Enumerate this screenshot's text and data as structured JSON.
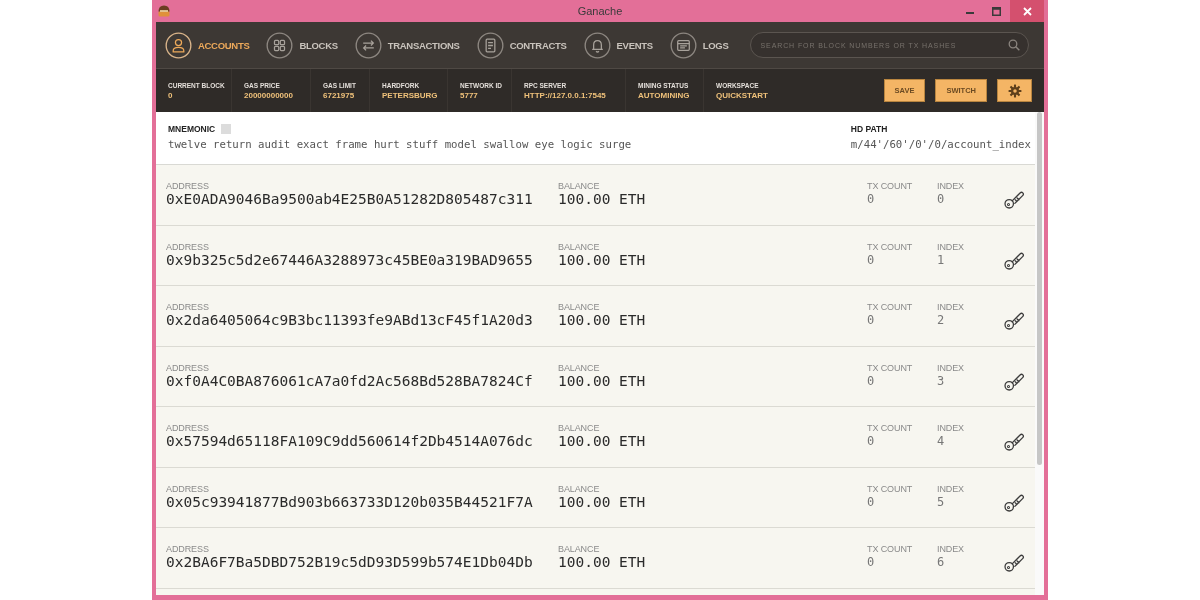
{
  "window": {
    "title": "Ganache"
  },
  "nav": {
    "tabs": [
      {
        "label": "ACCOUNTS",
        "selected": true
      },
      {
        "label": "BLOCKS",
        "selected": false
      },
      {
        "label": "TRANSACTIONS",
        "selected": false
      },
      {
        "label": "CONTRACTS",
        "selected": false
      },
      {
        "label": "EVENTS",
        "selected": false
      },
      {
        "label": "LOGS",
        "selected": false
      }
    ],
    "search": {
      "placeholder": "SEARCH FOR BLOCK NUMBERS OR TX HASHES"
    }
  },
  "status_bar": {
    "stats": [
      {
        "label": "CURRENT BLOCK",
        "value": "0"
      },
      {
        "label": "GAS PRICE",
        "value": "20000000000"
      },
      {
        "label": "GAS LIMIT",
        "value": "6721975"
      },
      {
        "label": "HARDFORK",
        "value": "PETERSBURG"
      },
      {
        "label": "NETWORK ID",
        "value": "5777"
      },
      {
        "label": "RPC SERVER",
        "value": "HTTP://127.0.0.1:7545"
      },
      {
        "label": "MINING STATUS",
        "value": "AUTOMINING"
      },
      {
        "label": "WORKSPACE",
        "value": "QUICKSTART"
      }
    ],
    "buttons": [
      "SAVE",
      "SWITCH"
    ]
  },
  "mnemonic": {
    "label": "MNEMONIC",
    "words": "twelve return audit exact frame hurt stuff model swallow eye logic surge",
    "hd_path_label": "HD PATH",
    "hd_path": "m/44'/60'/0'/0/account_index"
  },
  "accounts": [
    {
      "address_label": "ADDRESS",
      "address": "0xE0ADA9046Ba9500ab4E25B0A51282D805487c311",
      "balance_label": "BALANCE",
      "balance": "100.00 ETH",
      "tx_count_label": "TX COUNT",
      "tx_count": "0",
      "index_label": "INDEX",
      "index": "0"
    },
    {
      "address_label": "ADDRESS",
      "address": "0x9b325c5d2e67446A3288973c45BE0a319BAD9655",
      "balance_label": "BALANCE",
      "balance": "100.00 ETH",
      "tx_count_label": "TX COUNT",
      "tx_count": "0",
      "index_label": "INDEX",
      "index": "1"
    },
    {
      "address_label": "ADDRESS",
      "address": "0x2da6405064c9B3bc11393fe9ABd13cF45f1A20d3",
      "balance_label": "BALANCE",
      "balance": "100.00 ETH",
      "tx_count_label": "TX COUNT",
      "tx_count": "0",
      "index_label": "INDEX",
      "index": "2"
    },
    {
      "address_label": "ADDRESS",
      "address": "0xf0A4C0BA876061cA7a0fd2Ac568Bd528BA7824Cf",
      "balance_label": "BALANCE",
      "balance": "100.00 ETH",
      "tx_count_label": "TX COUNT",
      "tx_count": "0",
      "index_label": "INDEX",
      "index": "3"
    },
    {
      "address_label": "ADDRESS",
      "address": "0x57594d65118FA109C9dd560614f2Db4514A076dc",
      "balance_label": "BALANCE",
      "balance": "100.00 ETH",
      "tx_count_label": "TX COUNT",
      "tx_count": "0",
      "index_label": "INDEX",
      "index": "4"
    },
    {
      "address_label": "ADDRESS",
      "address": "0x05c93941877Bd903b663733D120b035B44521F7A",
      "balance_label": "BALANCE",
      "balance": "100.00 ETH",
      "tx_count_label": "TX COUNT",
      "tx_count": "0",
      "index_label": "INDEX",
      "index": "5"
    },
    {
      "address_label": "ADDRESS",
      "address": "0x2BA6F7Ba5DBD752B19c5dD93D599b574E1Db04Db",
      "balance_label": "BALANCE",
      "balance": "100.00 ETH",
      "tx_count_label": "TX COUNT",
      "tx_count": "0",
      "index_label": "INDEX",
      "index": "6"
    }
  ]
}
